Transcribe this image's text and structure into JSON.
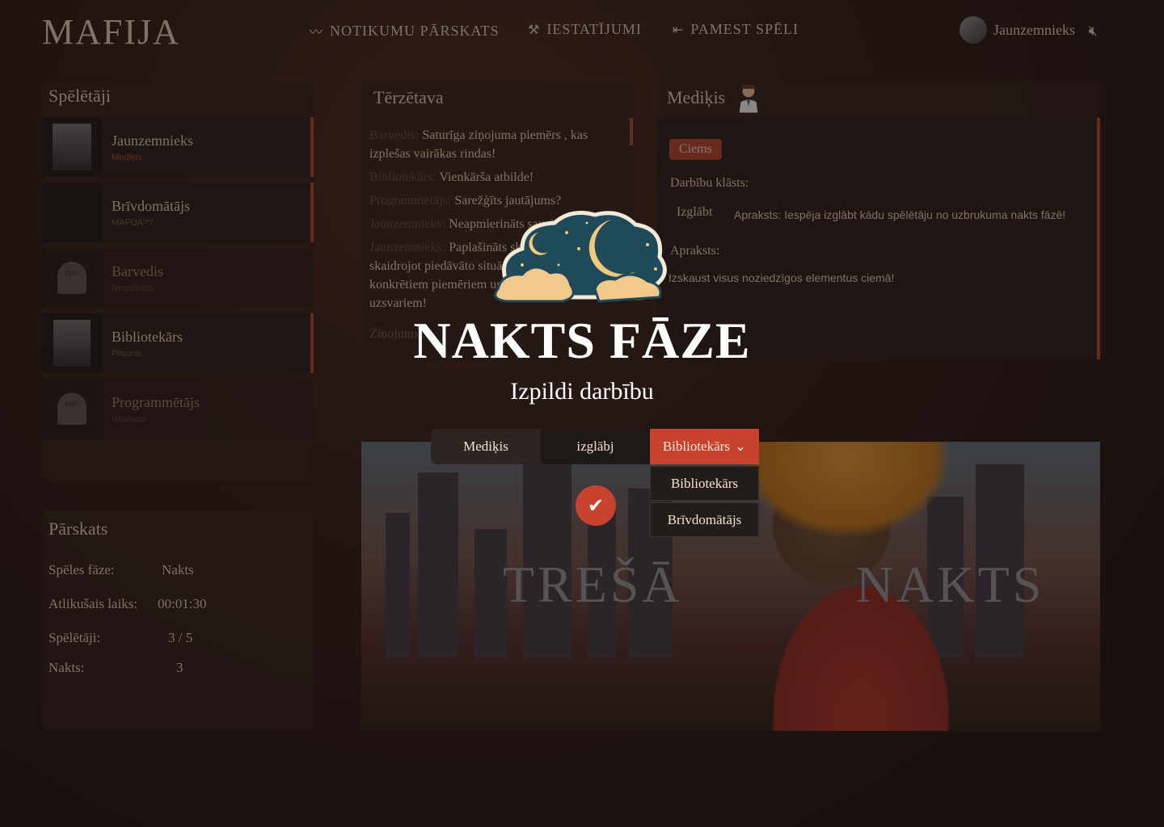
{
  "header": {
    "logo": "MAFIJA",
    "nav": [
      {
        "label": "NOTIKUMU PĀRSKATS",
        "icon": "timeline-icon"
      },
      {
        "label": "IESTATĪJUMI",
        "icon": "tools-icon"
      },
      {
        "label": "PAMEST SPĒLI",
        "icon": "exit-icon"
      }
    ],
    "user_name": "Jaunzemnieks"
  },
  "players": {
    "title": "Spēlētāji",
    "items": [
      {
        "name": "Jaunzemnieks",
        "role": "Mediķis"
      },
      {
        "name": "Brīvdomātājs",
        "role": "MAFIJA??"
      },
      {
        "name": "Barvedis",
        "role": "Nogalināts"
      },
      {
        "name": "Bibliotekārs",
        "role": "Pilsonis"
      },
      {
        "name": "Programmētājs",
        "role": "Izbalsots"
      }
    ]
  },
  "overview": {
    "title": "Pārskats",
    "rows": [
      {
        "label": "Spēles fāze:",
        "value": "Nakts"
      },
      {
        "label": "Atlikušais laiks:",
        "value": "00:01:30"
      },
      {
        "label": "Spēlētāji:",
        "value": "3 / 5"
      },
      {
        "label": "Nakts:",
        "value": "3"
      }
    ]
  },
  "chat": {
    "title": "Tērzētava",
    "messages": [
      {
        "who": "Barvedis:",
        "text": "Saturīga ziņojuma piemērs , kas izplešas vairākas rindas!"
      },
      {
        "who": "Bibliotekārs:",
        "text": "Vienkārša atbilde!"
      },
      {
        "who": "Programmētājs:",
        "text": "Sarežģīts jautājums?"
      },
      {
        "who": "Jaunzemnieks:",
        "text": "Neapmierināts sauciens!"
      },
      {
        "who": "Jaunzemnieks:",
        "text": "Paplašināts skaidrojums, kas skaidrojot piedāvāto situāciju balstās uz konkrētiem piemēriem un atbilstošiem uzsvariem!"
      }
    ],
    "input_placeholder": "Ziņojums..."
  },
  "role_panel": {
    "title": "Mediķis",
    "badge": "Ciems",
    "actions_label": "Darbību klāsts:",
    "action_button": "Izglābt",
    "action_desc": "Apraksts: Iespēja izglābt kādu spēlētāju no uzbrukuma nakts fāzē!",
    "desc_label": "Apraksts:",
    "desc": "Izskaust visus noziedzīgos elementus ciemā!"
  },
  "scene": {
    "word_left": "TREŠĀ",
    "word_right": "NAKTS"
  },
  "phase": {
    "title": "NAKTS FĀZE",
    "subtitle": "Izpildi darbību"
  },
  "action_bar": {
    "role": "Mediķis",
    "verb": "izglābj",
    "target": "Bibliotekārs",
    "options": [
      "Bibliotekārs",
      "Brīvdomātājs"
    ]
  },
  "colors": {
    "accent": "#c8432d",
    "panel": "#30221e",
    "text": "#d6c5ae"
  }
}
